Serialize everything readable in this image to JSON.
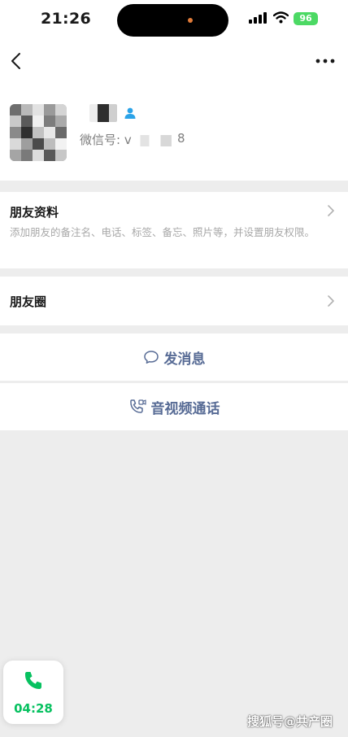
{
  "status_bar": {
    "time": "21:26",
    "battery": "96"
  },
  "profile": {
    "wechat_id_label": "微信号: v",
    "wechat_id_tail": "8"
  },
  "friend_info": {
    "title": "朋友资料",
    "description": "添加朋友的备注名、电话、标签、备忘、照片等，并设置朋友权限。"
  },
  "moments": {
    "title": "朋友圈"
  },
  "actions": {
    "message": "发消息",
    "call": "音视频通话"
  },
  "floating_call": {
    "duration": "04:28"
  },
  "watermark": "搜狐号@共产圈",
  "colors": {
    "link": "#576b95",
    "call_green": "#07c160",
    "badge_blue": "#2ba3e8"
  }
}
